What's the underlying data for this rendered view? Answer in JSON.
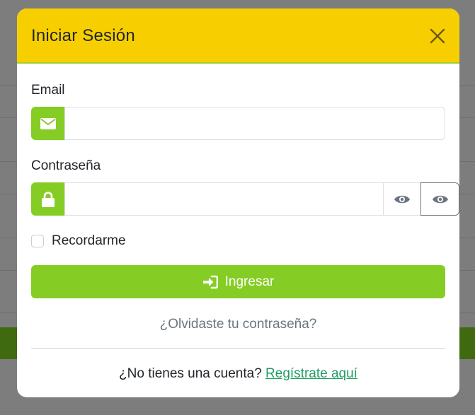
{
  "modal": {
    "title": "Iniciar Sesión",
    "close_icon": "close-icon"
  },
  "form": {
    "email": {
      "label": "Email",
      "value": "",
      "placeholder": "",
      "icon": "envelope-icon"
    },
    "password": {
      "label": "Contraseña",
      "value": "",
      "placeholder": "",
      "icon": "lock-icon",
      "toggle_icons": [
        "eye-icon",
        "eye-icon"
      ]
    },
    "remember_label": "Recordarme",
    "remember_checked": false,
    "submit_label": "Ingresar",
    "submit_icon": "sign-in-icon"
  },
  "links": {
    "forgot_password": "¿Olvidaste tu contraseña?",
    "no_account_text": "¿No tienes una cuenta?",
    "register": "Regístrate aquí"
  },
  "colors": {
    "header_bg": "#f7cf00",
    "accent_green": "#85cd25",
    "link_green": "#1f9c64"
  }
}
